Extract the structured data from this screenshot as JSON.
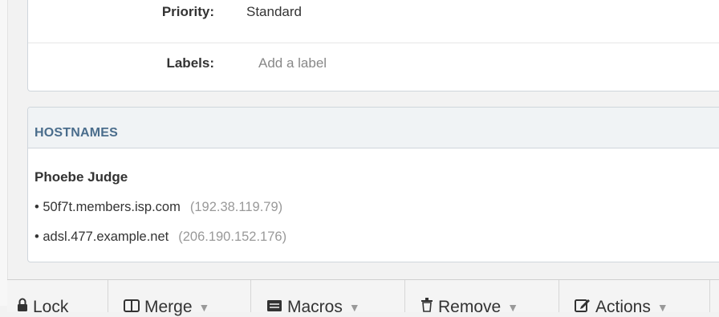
{
  "properties": {
    "priority_label": "Priority:",
    "priority_value": "Standard",
    "labels_label": "Labels:",
    "labels_placeholder": "Add a label"
  },
  "hostnames": {
    "title": "HOSTNAMES",
    "person": "Phoebe Judge",
    "entries": [
      {
        "host": "• 50f7t.members.isp.com",
        "ip": "(192.38.119.79)"
      },
      {
        "host": "• adsl.477.example.net",
        "ip": "(206.190.152.176)"
      }
    ]
  },
  "toolbar": {
    "lock": {
      "label": "Lock",
      "icon": "lock-icon"
    },
    "merge": {
      "label": "Merge",
      "icon": "merge-icon"
    },
    "macros": {
      "label": "Macros",
      "icon": "macros-icon"
    },
    "remove": {
      "label": "Remove",
      "icon": "trash-icon"
    },
    "actions": {
      "label": "Actions",
      "icon": "edit-icon"
    },
    "caret": "▼"
  }
}
